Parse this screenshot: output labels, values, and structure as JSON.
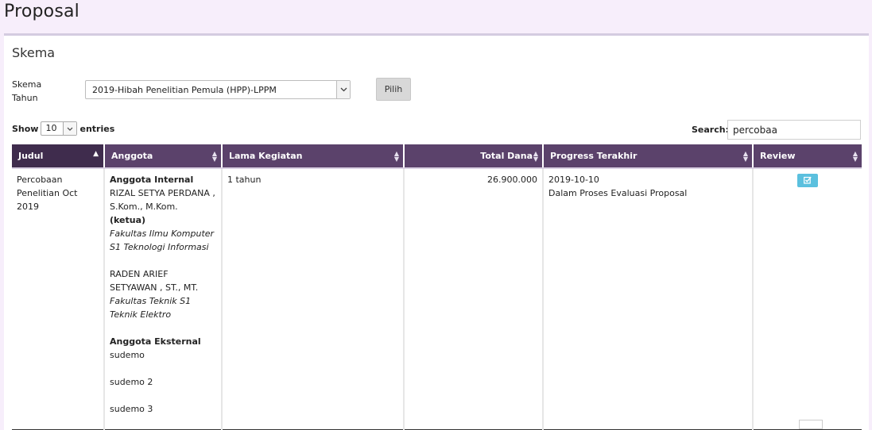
{
  "page": {
    "title": "Proposal"
  },
  "panel": {
    "title": "Skema",
    "form_label_line1": "Skema",
    "form_label_line2": "Tahun",
    "skema_select_value": "2019-Hibah Penelitian Pemula (HPP)-LPPM",
    "pilih_label": "Pilih"
  },
  "table_controls": {
    "show_label": "Show",
    "length_value": "10",
    "entries_label": "entries",
    "search_label": "Search:",
    "search_value": "percobaa"
  },
  "table": {
    "columns": [
      "Judul",
      "Anggota",
      "Lama Kegiatan",
      "Total Dana",
      "Progress Terakhir",
      "Review"
    ],
    "rows": [
      {
        "judul": "Percobaan Penelitian Oct 2019",
        "anggota_internal_label": "Anggota Internal",
        "internal_members": [
          {
            "name": "RIZAL SETYA PERDANA , S.Kom., M.Kom.",
            "role": "(ketua)",
            "unit": "Fakultas Ilmu Komputer S1 Teknologi Informasi"
          },
          {
            "name": "RADEN ARIEF SETYAWAN , ST., MT.",
            "role": "",
            "unit": "Fakultas Teknik S1 Teknik Elektro"
          }
        ],
        "anggota_eksternal_label": "Anggota Eksternal",
        "external_members": [
          "sudemo",
          "sudemo 2",
          "sudemo 3"
        ],
        "lama_kegiatan": "1 tahun",
        "total_dana": "26.900.000",
        "progress_date": "2019-10-10",
        "progress_status": "Dalam Proses Evaluasi Proposal"
      }
    ]
  },
  "colors": {
    "header_bg": "#5b426b",
    "header_sorted_bg": "#3f2c4d",
    "page_bg": "#f7eefb",
    "review_button": "#5bc0de"
  },
  "icons": {
    "sort": "sort-both-icon",
    "sort_asc": "sort-asc-icon",
    "review": "edit-check-icon",
    "dropdown": "chevron-down-icon"
  }
}
